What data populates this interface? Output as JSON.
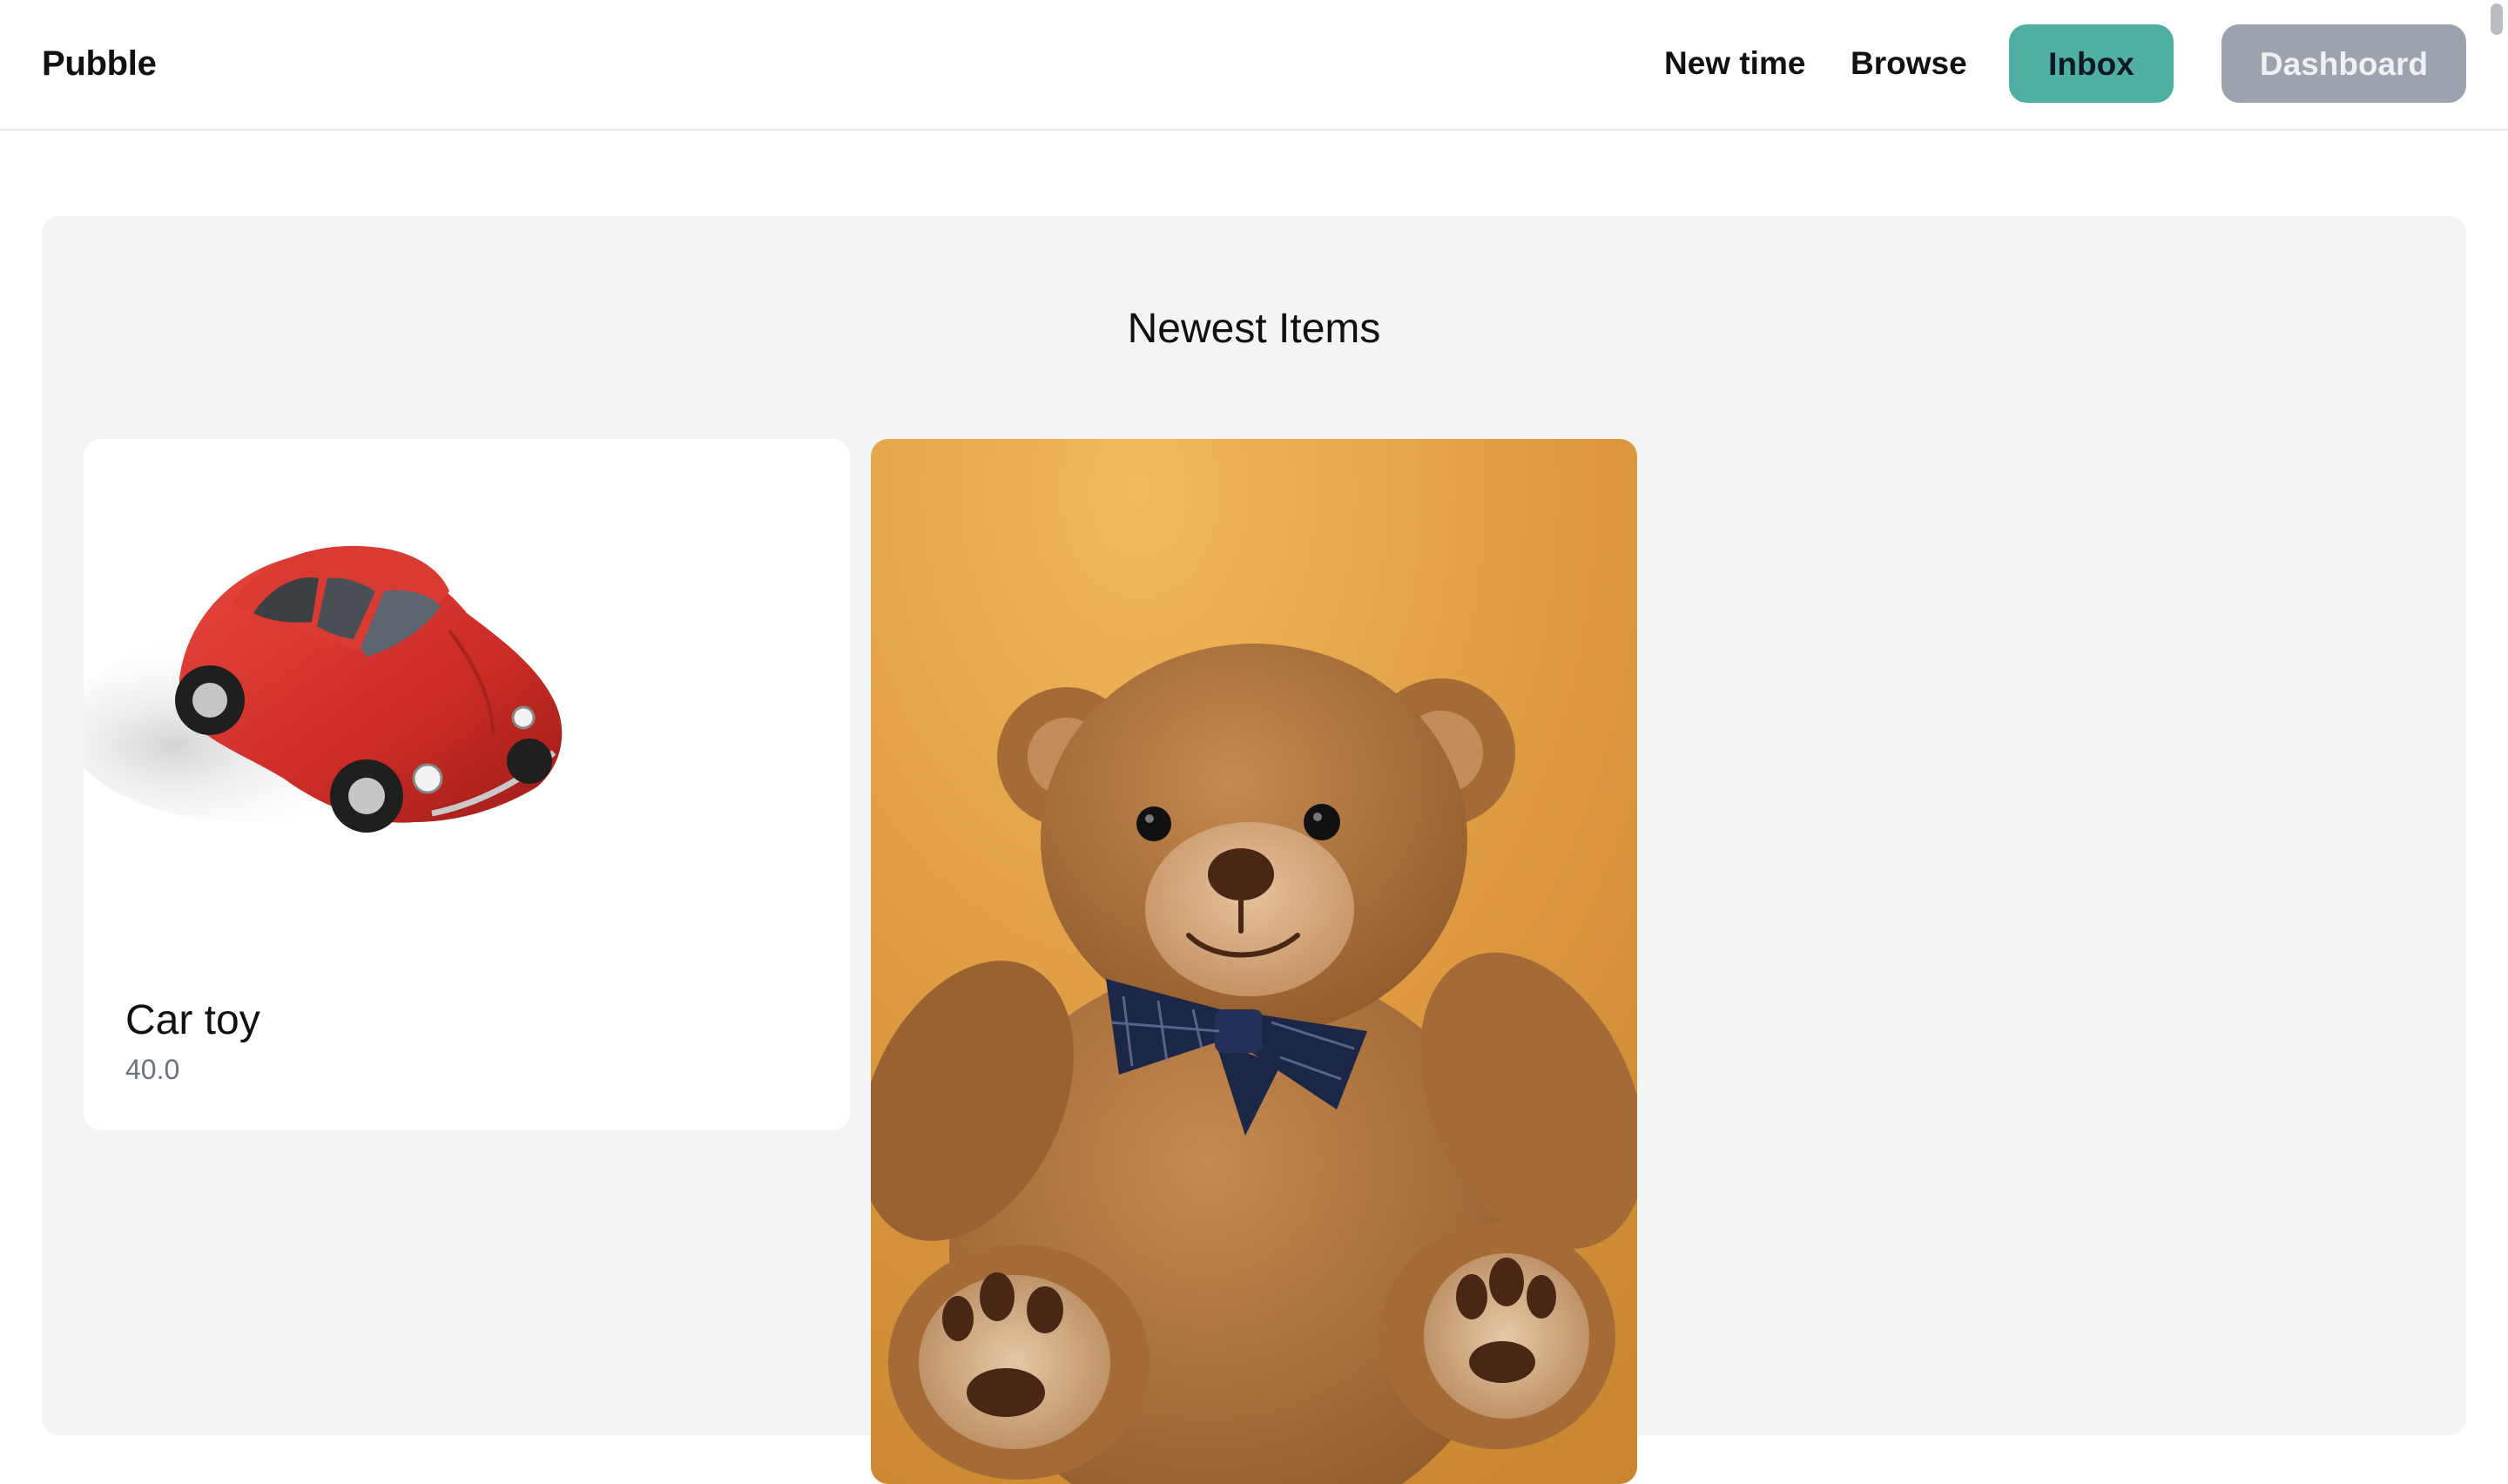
{
  "header": {
    "brand": "Pubble",
    "nav": {
      "new_item_label": "New time",
      "browse_label": "Browse"
    },
    "inbox_label": "Inbox",
    "dashboard_label": "Dashboard"
  },
  "main": {
    "section_title": "Newest Items",
    "items": [
      {
        "name": "Car toy",
        "price": "40.0",
        "image": "red-toy-car-photo"
      },
      {
        "name": "",
        "price": "",
        "image": "teddy-bear-photo"
      }
    ]
  },
  "colors": {
    "inbox_button": "#4fb0a2",
    "dashboard_button": "#9ca3af",
    "panel_background": "#f3f4f6"
  }
}
